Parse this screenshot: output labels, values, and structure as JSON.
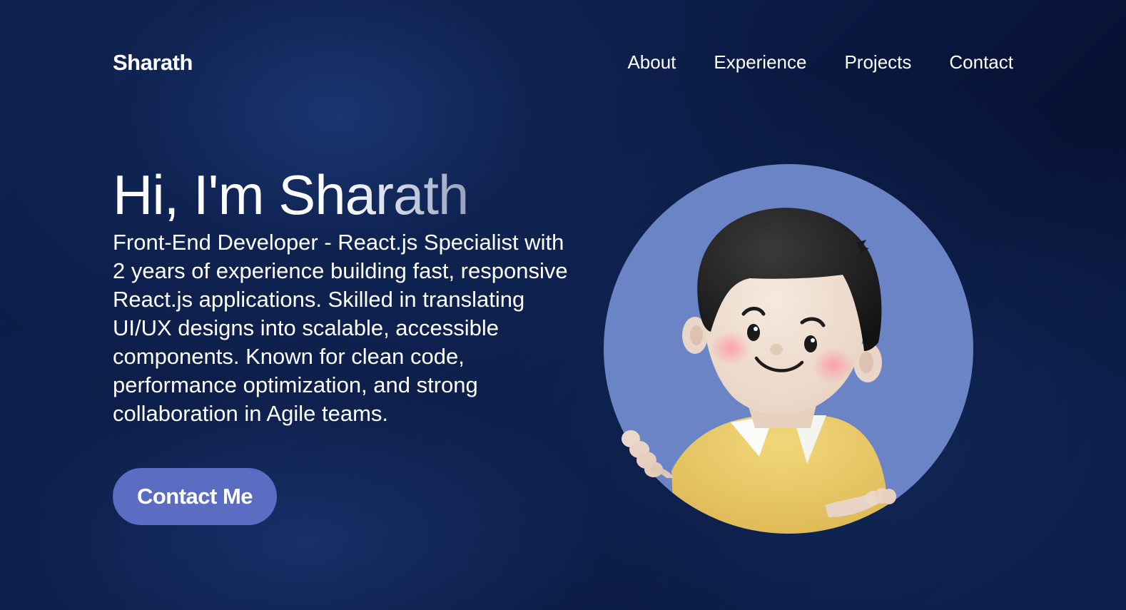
{
  "nav": {
    "brand": "Sharath",
    "links": [
      "About",
      "Experience",
      "Projects",
      "Contact"
    ]
  },
  "hero": {
    "title": "Hi, I'm Sharath",
    "description": "Front-End Developer - React.js Specialist with 2 years of experience building fast, responsive React.js applications. Skilled in translating UI/UX designs into scalable, accessible components. Known for clean code, performance optimization, and strong collaboration in Agile teams.",
    "cta_label": "Contact Me"
  },
  "colors": {
    "background": "#0b1c46",
    "accent": "#5b6cc3",
    "avatar_circle": "#6a84c6",
    "shirt": "#e8c563"
  },
  "avatar": {
    "icon": "cartoon-avatar-icon"
  }
}
